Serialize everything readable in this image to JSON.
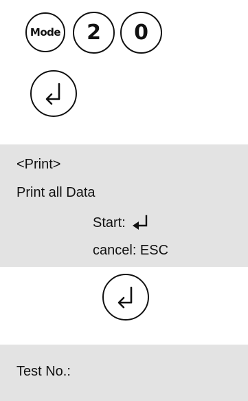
{
  "keys": {
    "mode_label": "Mode",
    "digit_1": "2",
    "digit_2": "0",
    "enter_icon": "enter-return-icon"
  },
  "print_screen": {
    "heading": "<Print>",
    "subtitle": "Print all Data",
    "start_label": "Start:",
    "start_icon": "enter-return-icon",
    "cancel_label": "cancel: ESC",
    "background": "#e3e3e3"
  },
  "test_screen": {
    "label": "Test No.:",
    "background": "#e3e3e3"
  }
}
